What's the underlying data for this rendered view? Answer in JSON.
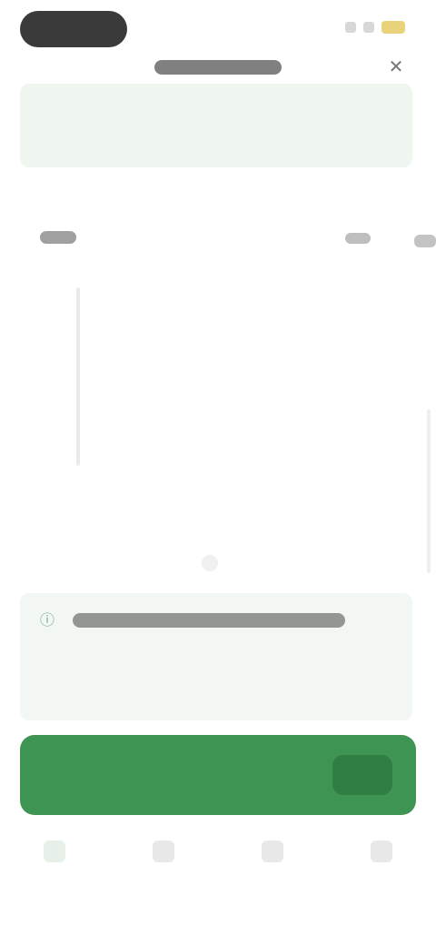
{
  "status_bar": {
    "time": "",
    "battery_color": "#e8d27a"
  },
  "nav": {
    "title": "",
    "close_icon": "close-icon"
  },
  "banner": {
    "text": ""
  },
  "timeline": {
    "start_label": "",
    "end_label": ""
  },
  "info_card": {
    "icon": "info-icon",
    "title": "",
    "text": ""
  },
  "primary_button": {
    "label": "",
    "color": "#3e9452"
  },
  "tabs": [
    {
      "label": "",
      "icon": "home-icon",
      "active": true
    },
    {
      "label": "",
      "icon": "list-icon",
      "active": false
    },
    {
      "label": "",
      "icon": "chat-icon",
      "active": false
    },
    {
      "label": "",
      "icon": "profile-icon",
      "active": false
    }
  ]
}
